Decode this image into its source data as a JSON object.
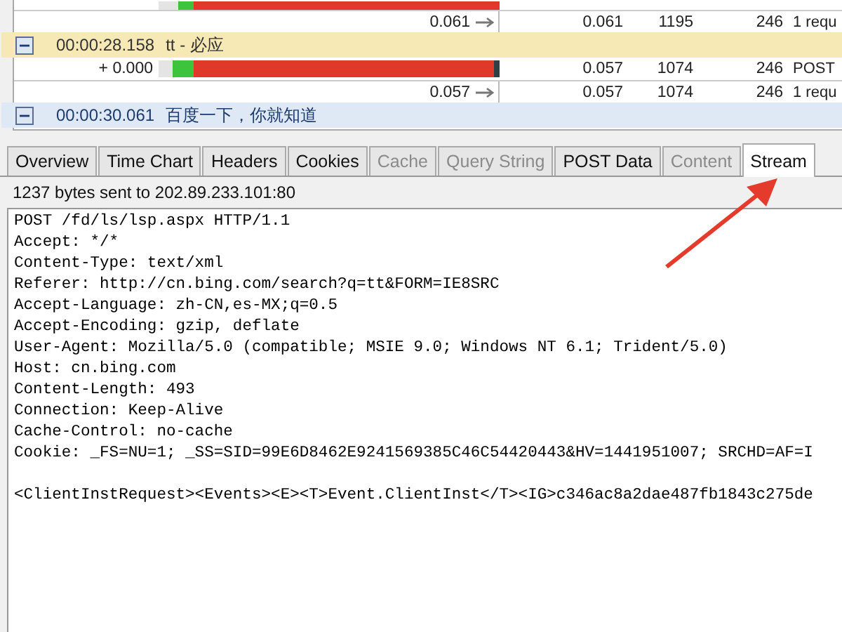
{
  "timeline": {
    "rows": [
      {
        "kind": "bar",
        "offset": "",
        "segments": [
          {
            "color": "#e4e4e4",
            "level": 0.057
          },
          {
            "color": "#3cc43c",
            "level": 0.046
          },
          {
            "color": "#e0392a",
            "level": 0.897
          }
        ],
        "cells": []
      },
      {
        "kind": "summary",
        "elapsed": "0.061",
        "cells": [
          "0.061",
          "1195",
          "246",
          "1 requ"
        ]
      },
      {
        "kind": "group",
        "time": "00:00:28.158",
        "title": "tt - 必应",
        "expanded": true,
        "selected": true
      },
      {
        "kind": "bar",
        "offset": "+ 0.000",
        "segments": [
          {
            "color": "#e4e4e4",
            "level": 0.042
          },
          {
            "color": "#3cc43c",
            "level": 0.062
          },
          {
            "color": "#e0392a",
            "level": 0.88
          },
          {
            "color": "#2f3f46",
            "level": 0.016
          }
        ],
        "cells": [
          "0.057",
          "1074",
          "246",
          "POST"
        ]
      },
      {
        "kind": "summary",
        "elapsed": "0.057",
        "cells": [
          "0.057",
          "1074",
          "246",
          "1 requ"
        ]
      },
      {
        "kind": "group",
        "time": "00:00:30.061",
        "title": "百度一下，你就知道",
        "expanded": true,
        "selected": false
      }
    ]
  },
  "tabs": [
    {
      "label": "Overview",
      "selected": false,
      "disabled": false
    },
    {
      "label": "Time Chart",
      "selected": false,
      "disabled": false
    },
    {
      "label": "Headers",
      "selected": false,
      "disabled": false
    },
    {
      "label": "Cookies",
      "selected": false,
      "disabled": false
    },
    {
      "label": "Cache",
      "selected": false,
      "disabled": true
    },
    {
      "label": "Query String",
      "selected": false,
      "disabled": true
    },
    {
      "label": "POST Data",
      "selected": false,
      "disabled": false
    },
    {
      "label": "Content",
      "selected": false,
      "disabled": true
    },
    {
      "label": "Stream",
      "selected": true,
      "disabled": false
    }
  ],
  "status": "1237 bytes sent to 202.89.233.101:80",
  "stream": {
    "headers": [
      "POST /fd/ls/lsp.aspx HTTP/1.1",
      "Accept: */*",
      "Content-Type: text/xml",
      "Referer: http://cn.bing.com/search?q=tt&FORM=IE8SRC",
      "Accept-Language: zh-CN,es-MX;q=0.5",
      "Accept-Encoding: gzip, deflate",
      "User-Agent: Mozilla/5.0 (compatible; MSIE 9.0; Windows NT 6.1; Trident/5.0)",
      "Host: cn.bing.com",
      "Content-Length: 493",
      "Connection: Keep-Alive",
      "Cache-Control: no-cache",
      "Cookie: _FS=NU=1; _SS=SID=99E6D8462E9241569385C46C54420443&HV=1441951007; SRCHD=AF=I"
    ],
    "body": [
      "<ClientInstRequest><Events><E><T>Event.ClientInst</T><IG>c346ac8a2dae487fb1843c275de"
    ]
  }
}
